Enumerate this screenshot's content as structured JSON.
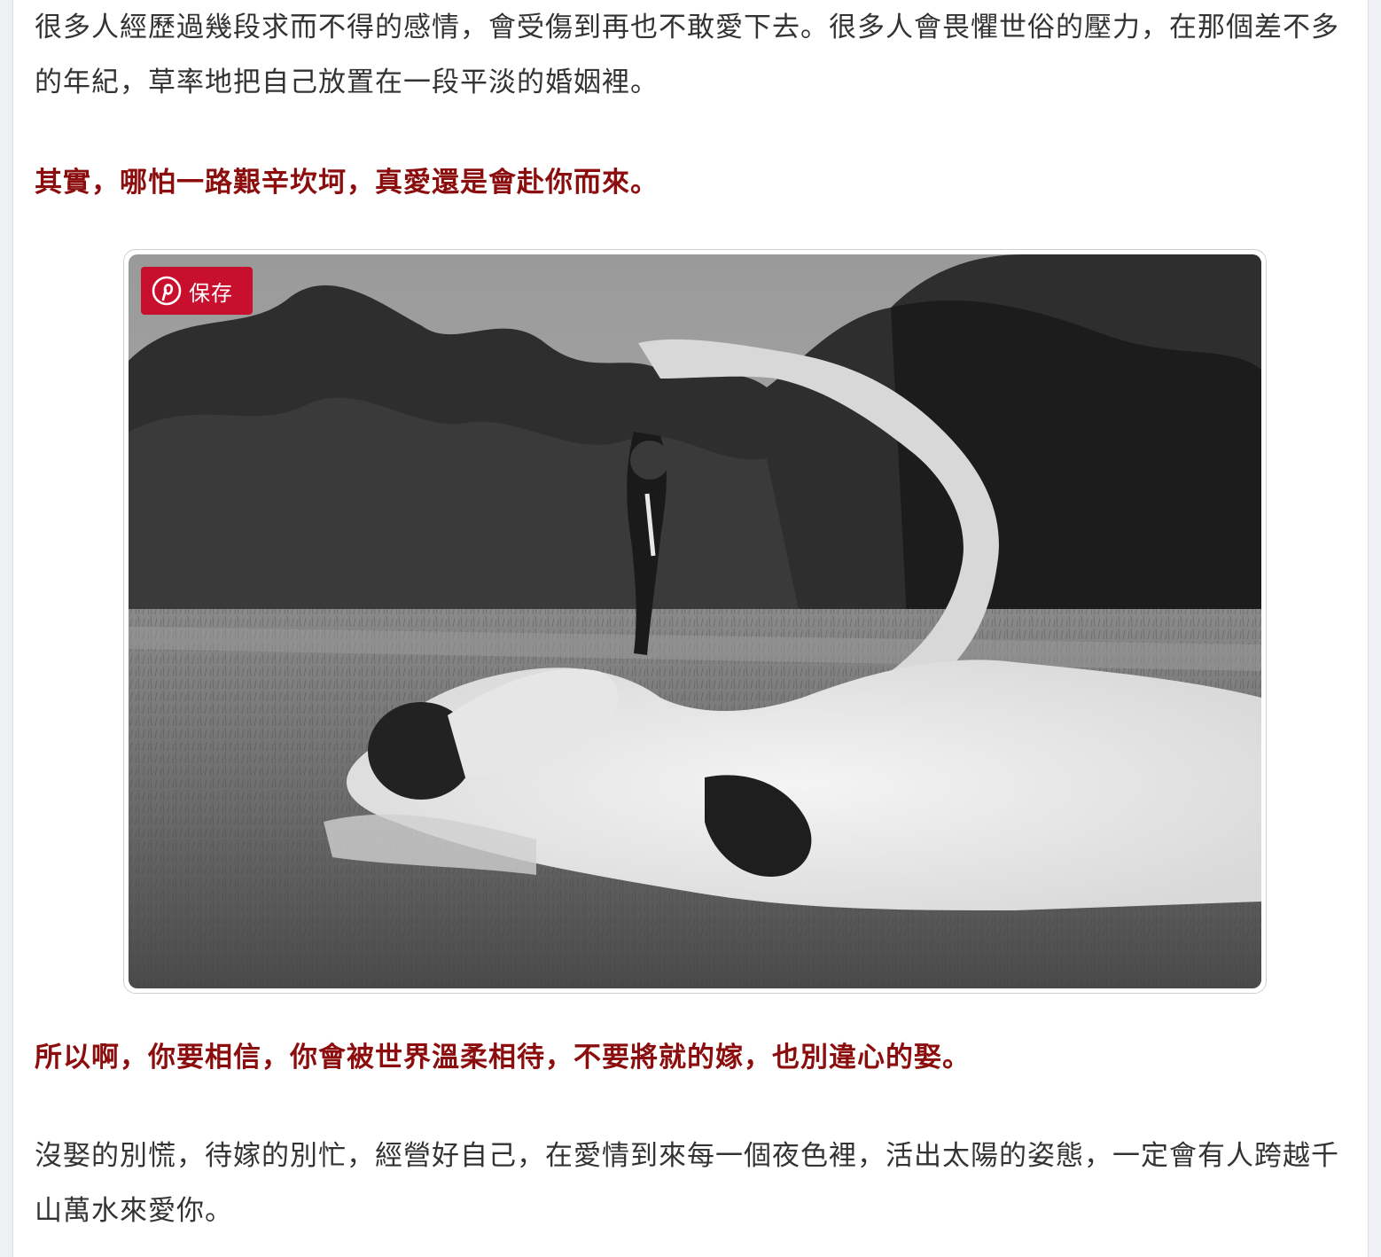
{
  "article": {
    "paragraphs": {
      "p1": "很多人經歷過幾段求而不得的感情，會受傷到再也不敢愛下去。很多人會畏懼世俗的壓力，在那個差不多的年紀，草率地把自己放置在一段平淡的婚姻裡。",
      "p2": "其實，哪怕一路艱辛坎坷，真愛還是會赴你而來。",
      "p3": "所以啊，你要相信，你會被世界溫柔相待，不要將就的嫁，也別違心的娶。",
      "p4": "沒娶的別慌，待嫁的別忙，經營好自己，在愛情到來每一個夜色裡，活出太陽的姿態，一定會有人跨越千山萬水來愛你。"
    },
    "image": {
      "save_button_label": "保存",
      "save_button_icon": "pinterest-icon",
      "save_button_color": "#c8102e"
    }
  },
  "colors": {
    "body_text": "#333333",
    "highlight_text": "#8b0d0d"
  }
}
